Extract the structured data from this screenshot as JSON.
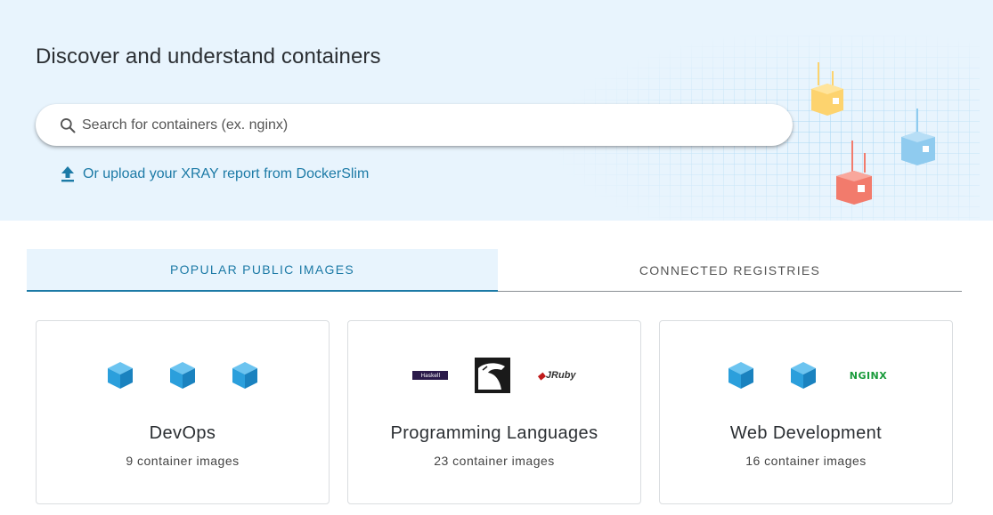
{
  "hero": {
    "title": "Discover and understand containers",
    "search_placeholder": "Search for containers (ex. nginx)",
    "upload_label": "Or upload your XRAY report from DockerSlim"
  },
  "tabs": [
    {
      "label": "POPULAR PUBLIC IMAGES",
      "active": true
    },
    {
      "label": "CONNECTED REGISTRIES",
      "active": false
    }
  ],
  "cards": [
    {
      "title": "DevOps",
      "subtitle": "9 container images",
      "icons": [
        "cube-icon",
        "cube-icon",
        "cube-icon"
      ]
    },
    {
      "title": "Programming Languages",
      "subtitle": "23 container images",
      "icons": [
        "haskell-logo",
        "racket-logo",
        "jruby-logo"
      ]
    },
    {
      "title": "Web Development",
      "subtitle": "16 container images",
      "icons": [
        "cube-icon",
        "cube-icon",
        "nginx-logo"
      ]
    }
  ],
  "logos": {
    "haskell": "Haskell",
    "jruby": "JRuby",
    "nginx": "NGINX"
  },
  "colors": {
    "accent": "#1c7aa6",
    "hero_bg": "#e8f4fd",
    "cube": "#2b9fdc",
    "container_yellow": "#fdd36e",
    "container_red": "#f27b6c",
    "container_blue": "#8fcbef"
  }
}
